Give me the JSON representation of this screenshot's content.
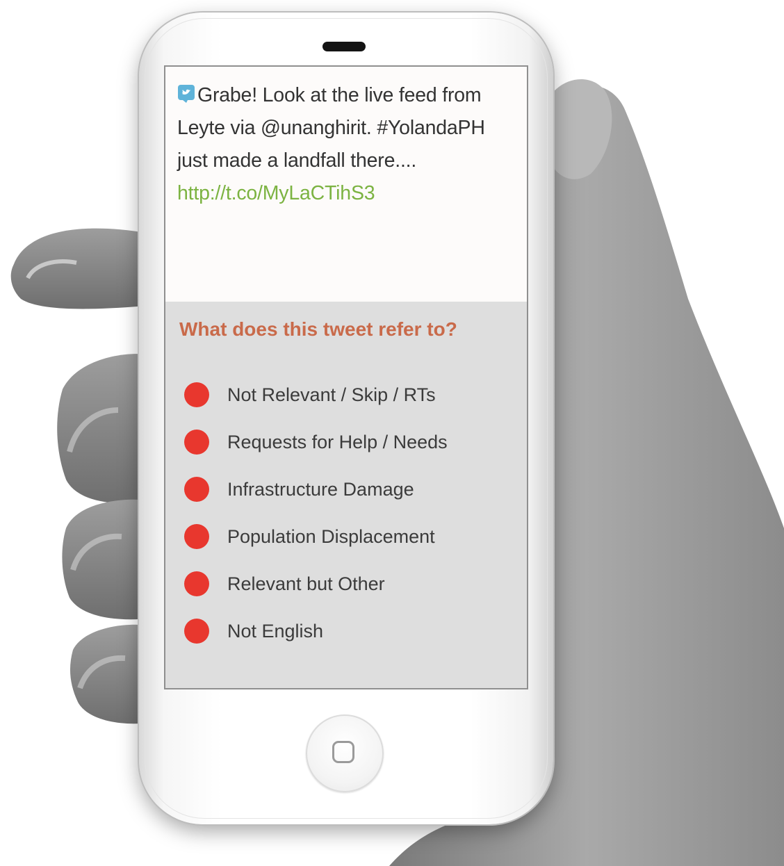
{
  "tweet": {
    "text": "Grabe! Look at the live feed from Leyte via @unanghirit. #YolandaPH just made a landfall there.... ",
    "link": "http://t.co/MyLaCTihS3",
    "icon": "twitter-bird-icon"
  },
  "question": {
    "title": "What does this tweet refer to?",
    "options": [
      {
        "label": "Not Relevant / Skip / RTs"
      },
      {
        "label": "Requests for Help / Needs"
      },
      {
        "label": "Infrastructure Damage"
      },
      {
        "label": "Population Displacement"
      },
      {
        "label": "Relevant but Other"
      },
      {
        "label": "Not English"
      }
    ]
  },
  "colors": {
    "accent_title": "#c96a4a",
    "option_dot": "#e8372e",
    "link": "#7cb342",
    "question_background": "#dedede",
    "tweet_background": "#fdfbfa"
  },
  "icons": {
    "home_button": "home-square-icon",
    "speaker": "earpiece-speaker"
  }
}
